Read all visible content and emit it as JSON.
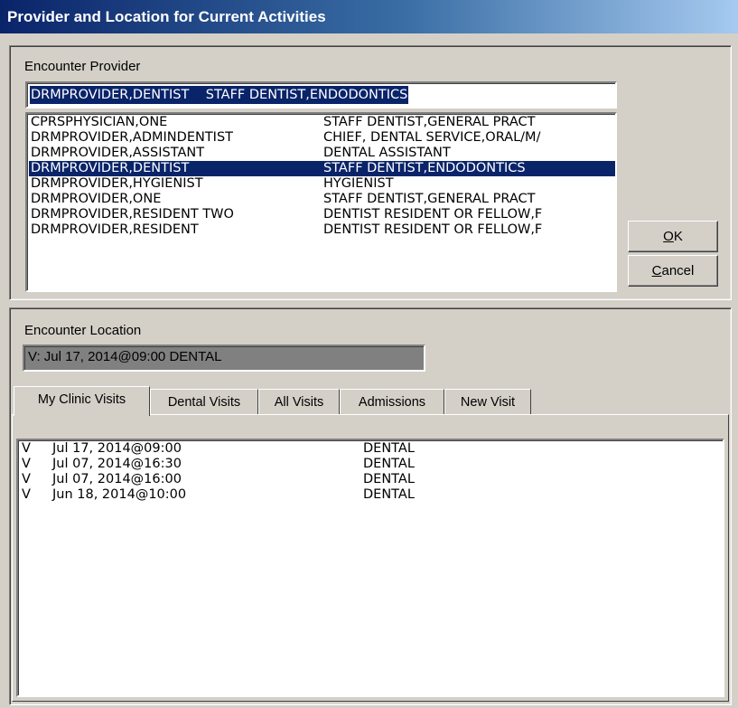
{
  "window": {
    "title": "Provider and Location for Current Activities"
  },
  "provider": {
    "label": "Encounter Provider",
    "selected_value": "DRMPROVIDER,DENTIST    STAFF DENTIST,ENDODONTICS",
    "items": [
      {
        "name": "CPRSPHYSICIAN,ONE",
        "title": "STAFF DENTIST,GENERAL PRACT",
        "selected": false
      },
      {
        "name": "DRMPROVIDER,ADMINDENTIST",
        "title": "CHIEF, DENTAL SERVICE,ORAL/M/",
        "selected": false
      },
      {
        "name": "DRMPROVIDER,ASSISTANT",
        "title": "DENTAL ASSISTANT",
        "selected": false
      },
      {
        "name": "DRMPROVIDER,DENTIST",
        "title": "STAFF DENTIST,ENDODONTICS",
        "selected": true
      },
      {
        "name": "DRMPROVIDER,HYGIENIST",
        "title": "HYGIENIST",
        "selected": false
      },
      {
        "name": "DRMPROVIDER,ONE",
        "title": "STAFF DENTIST,GENERAL PRACT",
        "selected": false
      },
      {
        "name": "DRMPROVIDER,RESIDENT TWO",
        "title": "DENTIST RESIDENT OR FELLOW,F",
        "selected": false
      },
      {
        "name": "DRMPROVIDER,RESIDENT",
        "title": "DENTIST RESIDENT OR FELLOW,F",
        "selected": false
      }
    ]
  },
  "buttons": {
    "ok": {
      "accel": "O",
      "rest": "K"
    },
    "cancel": {
      "accel": "C",
      "rest": "ancel"
    }
  },
  "location": {
    "label": "Encounter Location",
    "value": "V: Jul 17, 2014@09:00 DENTAL"
  },
  "tabs": [
    {
      "label": "My Clinic Visits",
      "active": true
    },
    {
      "label": "Dental Visits",
      "active": false
    },
    {
      "label": "All Visits",
      "active": false
    },
    {
      "label": "Admissions",
      "active": false
    },
    {
      "label": "New Visit",
      "active": false
    }
  ],
  "visits": [
    {
      "type": "V",
      "datetime": "Jul 17, 2014@09:00",
      "location": "DENTAL"
    },
    {
      "type": "V",
      "datetime": "Jul 07, 2014@16:30",
      "location": "DENTAL"
    },
    {
      "type": "V",
      "datetime": "Jul 07, 2014@16:00",
      "location": "DENTAL"
    },
    {
      "type": "V",
      "datetime": "Jun 18, 2014@10:00",
      "location": "DENTAL"
    }
  ]
}
